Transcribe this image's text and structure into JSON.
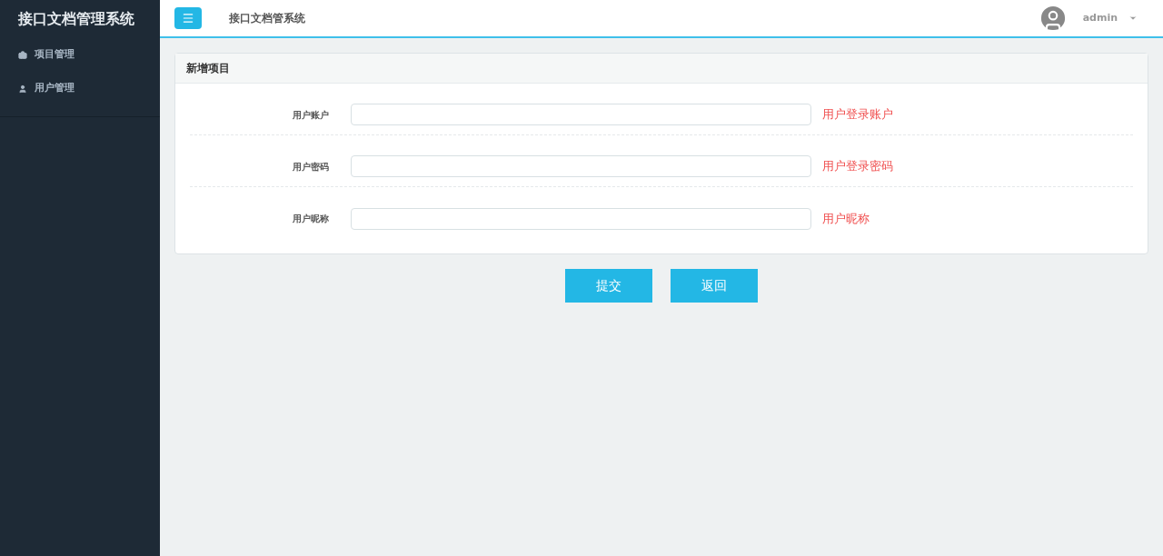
{
  "sidebar": {
    "title": "接口文档管理系统",
    "items": [
      {
        "kind": "project",
        "label": "项目管理"
      },
      {
        "kind": "user",
        "label": "用户管理"
      }
    ]
  },
  "header": {
    "title": "接口文档管系统",
    "user": "admin"
  },
  "form": {
    "title": "新增项目",
    "fields": [
      {
        "label": "用户账户",
        "hint": "用户登录账户"
      },
      {
        "label": "用户密码",
        "hint": "用户登录密码"
      },
      {
        "label": "用户昵称",
        "hint": "用户昵称"
      }
    ]
  },
  "buttons": [
    "提交",
    "返回"
  ]
}
